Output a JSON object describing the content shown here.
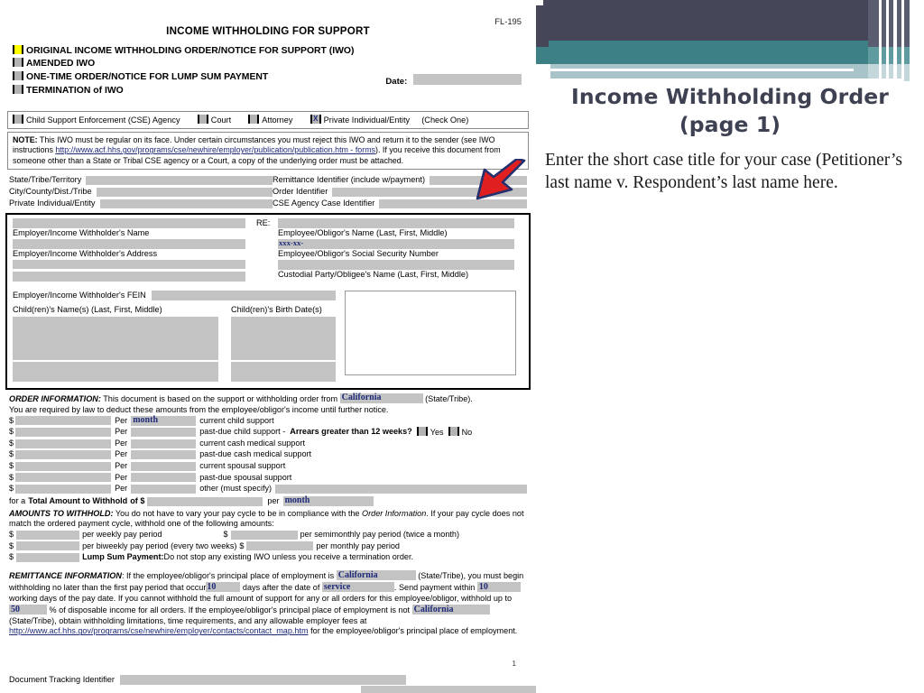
{
  "slide": {
    "title_line1": "Income Withholding Order",
    "title_line2": "(page 1)",
    "body": "Enter the short case title for your case (Petitioner’s last name v. Respondent’s last name here."
  },
  "colors": {
    "banner_dark": "#454759",
    "banner_teal": "#3d8187",
    "banner_pale": "#a9c4c8",
    "title_text": "#3e4152",
    "arrow_fill": "#e02020",
    "arrow_stroke": "#1e2a78",
    "filled_value": "#1e2a78",
    "field_gray": "#c3c3c3",
    "checkbox_checked": "#ffff00"
  },
  "form": {
    "form_number": "FL-195",
    "title": "INCOME WITHHOLDING FOR SUPPORT",
    "order_types": [
      {
        "label": "ORIGINAL INCOME WITHHOLDING ORDER/NOTICE FOR SUPPORT (IWO)",
        "checked": true
      },
      {
        "label": "AMENDED IWO",
        "checked": false
      },
      {
        "label": "ONE-TIME ORDER/NOTICE FOR LUMP SUM PAYMENT",
        "checked": false
      },
      {
        "label": "TERMINATION of IWO",
        "checked": false
      }
    ],
    "date_label": "Date:",
    "date_value": "",
    "sender_row": {
      "options": [
        {
          "label": "Child Support Enforcement (CSE) Agency",
          "mark": ""
        },
        {
          "label": "Court",
          "mark": ""
        },
        {
          "label": "Attorney",
          "mark": ""
        },
        {
          "label": "Private Individual/Entity",
          "mark": "X"
        }
      ],
      "suffix": "(Check One)"
    },
    "note": {
      "label": "NOTE:",
      "text_before_link": " This IWO must be regular on its face. Under certain circumstances you must reject this IWO and return it to the sender (see IWO instructions ",
      "link": "http://www.acf.hhs.gov/programs/cse/newhire/employer/publication/publication.htm - forms",
      "text_after_link": "). If you receive this document from someone other than a State or Tribal CSE agency or a Court, a copy of the underlying order must be attached."
    },
    "identifiers": {
      "left": [
        {
          "label": "State/Tribe/Territory",
          "value": ""
        },
        {
          "label": "City/County/Dist./Tribe",
          "value": ""
        },
        {
          "label": "Private Individual/Entity",
          "value": ""
        }
      ],
      "right": [
        {
          "label": "Remittance Identifier (include w/payment)",
          "value": ""
        },
        {
          "label": "Order Identifier",
          "value": ""
        },
        {
          "label": "CSE Agency Case Identifier",
          "value": ""
        }
      ]
    },
    "parties": {
      "re_label": "RE:",
      "employer_name_label": "Employer/Income Withholder's Name",
      "employer_address_label": "Employer/Income Withholder's Address",
      "employer_fein_label": "Employer/Income Withholder's FEIN",
      "employee_name_label": "Employee/Obligor's Name (Last, First, Middle)",
      "ssn_prefix": "xxx-xx-",
      "ssn_label": "Employee/Obligor's Social Security Number",
      "custodial_label": "Custodial Party/Obligee's Name (Last, First, Middle)",
      "children_names_label": "Child(ren)'s Name(s) (Last, First, Middle)",
      "children_dob_label": "Child(ren)'s Birth Date(s)"
    },
    "order_information": {
      "heading": "ORDER INFORMATION:",
      "intro_before_state": " This document is based on the support or withholding order from ",
      "state": "California",
      "intro_after_state": " (State/Tribe).",
      "intro_line2": "You are required by law to deduct these amounts from the employee/obligor's income until further notice.",
      "rows": [
        {
          "amount": "",
          "per_label": "Per",
          "period": "month",
          "description": "current child support",
          "extra": ""
        },
        {
          "amount": "",
          "per_label": "Per",
          "period": "",
          "description": "past-due child support -",
          "extra": "arrears"
        },
        {
          "amount": "",
          "per_label": "Per",
          "period": "",
          "description": "current cash medical support",
          "extra": ""
        },
        {
          "amount": "",
          "per_label": "Per",
          "period": "",
          "description": "past-due cash medical support",
          "extra": ""
        },
        {
          "amount": "",
          "per_label": "Per",
          "period": "",
          "description": "current spousal support",
          "extra": ""
        },
        {
          "amount": "",
          "per_label": "Per",
          "period": "",
          "description": "past-due spousal support",
          "extra": ""
        },
        {
          "amount": "",
          "per_label": "Per",
          "period": "",
          "description": "other (must specify)",
          "extra": "otherfield"
        }
      ],
      "arrears_question": "Arrears greater than 12 weeks?",
      "arrears_yes": "Yes",
      "arrears_no": "No",
      "total_prefix": "for a",
      "total_bold": "Total Amount to Withhold",
      "total_of": "of $",
      "total_amount": "",
      "total_per": "per",
      "total_period": "month"
    },
    "amounts_to_withhold": {
      "heading": "AMOUNTS TO WITHHOLD:",
      "intro": " You do not have to vary your pay cycle to be in compliance with the ",
      "intro_italic": "Order Information",
      "intro_end": ". If your pay cycle does not match the ordered payment cycle, withhold one of the following amounts:",
      "rows": [
        {
          "left_label": "per weekly pay period",
          "right_label": "per semimonthly pay period (twice a month)"
        },
        {
          "left_label": "per biweekly pay period (every two weeks)",
          "right_label": "per monthly pay period"
        }
      ],
      "lump_bold": "Lump Sum Payment:",
      "lump_text": " Do not stop any existing IWO unless you receive a termination order."
    },
    "remittance": {
      "heading": "REMITTANCE INFORMATION",
      "t1": ": If the employee/obligor's principal place of employment is ",
      "state1": "California",
      "t2": " (State/Tribe), you must begin withholding no later than the first pay period that occur",
      "days1": "10",
      "t3": " days after the date of ",
      "service": "service",
      "t4": ". Send payment within ",
      "days2": "10",
      "t5": " working days of the pay date. If you cannot withhold the full amount of support for any or all orders for this employee/obligor, withhold up to ",
      "pct": "50",
      "t6": " % of disposable income for all orders. If the employee/obligor's principal place of employment is not ",
      "state2": "California",
      "t7": " (State/Tribe), obtain withholding limitations, time requirements, and any allowable employer fees at ",
      "link": "http://www.acf.hhs.gov/programs/cse/newhire/employer/contacts/contact_map.htm",
      "t8": " for the employee/obligor's principal place of employment."
    },
    "doc_tracking_label": "Document Tracking Identifier",
    "page_number": "1"
  }
}
